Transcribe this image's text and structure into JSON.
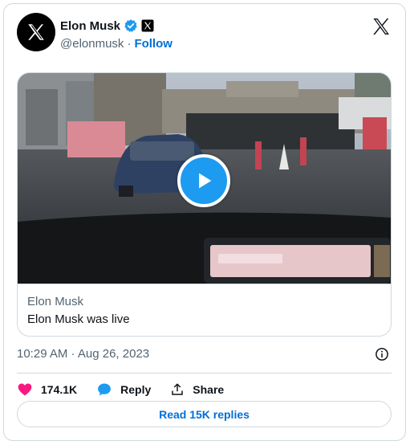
{
  "author": {
    "name": "Elon Musk",
    "handle": "@elonmusk",
    "separator": "·",
    "follow_label": "Follow"
  },
  "media_card": {
    "source": "Elon Musk",
    "title": "Elon Musk was live"
  },
  "timestamp": "10:29 AM · Aug 26, 2023",
  "actions": {
    "likes": "174.1K",
    "reply_label": "Reply",
    "share_label": "Share"
  },
  "replies_button": "Read 15K replies",
  "colors": {
    "accent": "#1d9bf0",
    "link": "#006fd6",
    "like": "#f91880",
    "border": "#cfd9de",
    "muted": "#536471"
  },
  "icons": [
    "x-logo-icon",
    "verified-badge-icon",
    "x-affiliate-badge-icon",
    "play-icon",
    "info-icon",
    "heart-icon",
    "reply-bubble-icon",
    "share-icon"
  ]
}
